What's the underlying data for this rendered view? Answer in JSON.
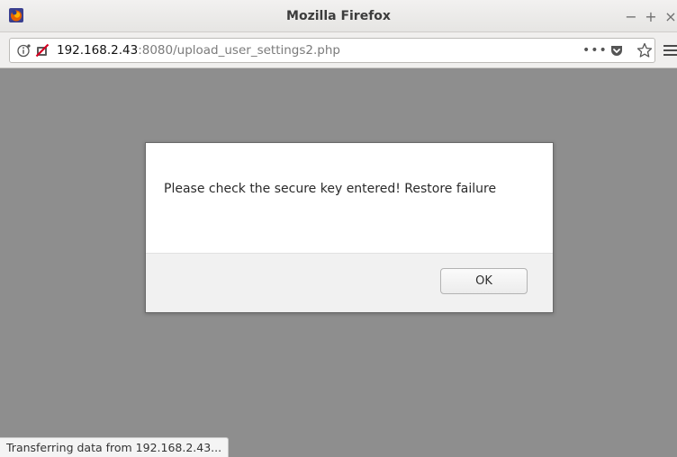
{
  "window": {
    "title": "Mozilla Firefox",
    "controls": {
      "minimize": "−",
      "maximize": "+",
      "close": "×"
    }
  },
  "urlbar": {
    "host": "192.168.2.43",
    "rest": ":8080/upload_user_settings2.php",
    "page_actions": "•••"
  },
  "dialog": {
    "message": "Please check the secure key entered! Restore failure",
    "ok_label": "OK"
  },
  "statusbar": {
    "text": "Transferring data from 192.168.2.43..."
  },
  "icons": {
    "firefox_logo": "firefox-logo-icon",
    "info": "info-icon",
    "insecure": "insecure-connection-icon",
    "page_actions": "page-actions-icon",
    "pocket": "pocket-icon",
    "bookmark": "star-icon",
    "menu": "hamburger-menu-icon"
  },
  "colors": {
    "content_overlay": "#8e8e8e",
    "titlebar": "#ecebe9",
    "firefox_orange": "#e66000",
    "insecure_red": "#d70022"
  }
}
